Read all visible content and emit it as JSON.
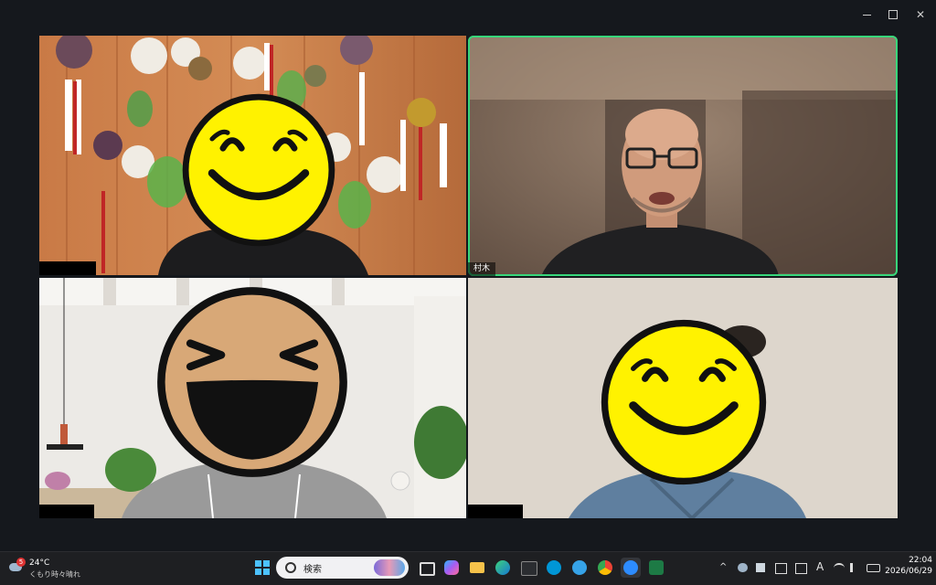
{
  "window_controls": {
    "minimize": "—",
    "restore": "❐",
    "close": "✕"
  },
  "participants": [
    {
      "name": "",
      "avatar_icon": "smiley-face-icon",
      "active_speaker": false
    },
    {
      "name": "村木",
      "avatar_icon": "",
      "active_speaker": true
    },
    {
      "name": "",
      "avatar_icon": "laughing-face-icon",
      "active_speaker": false
    },
    {
      "name": "",
      "avatar_icon": "smiley-face-icon",
      "active_speaker": false
    }
  ],
  "taskbar": {
    "weather": {
      "temp": "24°C",
      "desc": "くもり時々晴れ",
      "badge": "5"
    },
    "search_placeholder": "検索",
    "apps": [
      "start-icon",
      "search",
      "task-view-icon",
      "copilot-icon",
      "file-explorer-icon",
      "edge-icon",
      "store-icon",
      "hp-icon",
      "qq-icon",
      "chrome-icon",
      "zoom-icon",
      "excel-icon"
    ],
    "tray_ime": "A",
    "clock": {
      "time": "22:04",
      "date": "2026/06/29"
    }
  },
  "colors": {
    "active_border": "#37d67a",
    "smiley_yellow": "#fff200",
    "laugh_tan": "#d8a877"
  }
}
